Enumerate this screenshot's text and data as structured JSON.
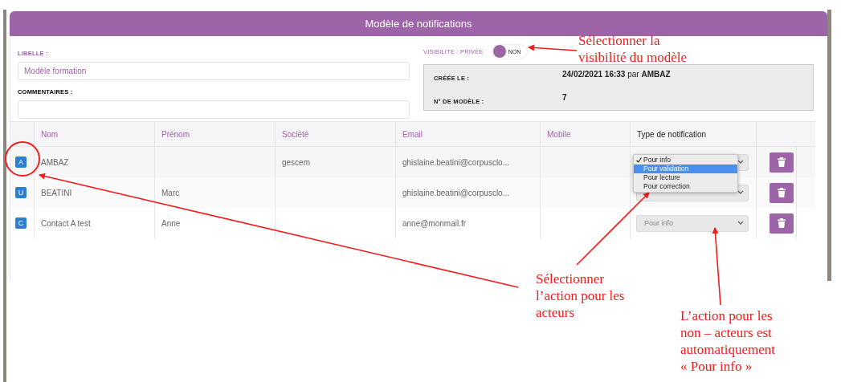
{
  "window": {
    "title": "Modèle de notifications"
  },
  "form": {
    "libelle_label": "LIBELLE :",
    "libelle_value": "Modèle formation",
    "comments_label": "COMMENTAIRES :",
    "visibility": {
      "label": "VISIBILITE : PRIVÉE",
      "toggle_text": "NON",
      "on": false
    },
    "info": [
      {
        "label": "CRÉÉE LE :",
        "value": "**24/02/2021 16:33** par **AMBAZ**"
      },
      {
        "label": "N° DE MODÈLE :",
        "value": "7"
      }
    ]
  },
  "table": {
    "columns": [
      {
        "kind": "plain"
      },
      {
        "label": "Nom",
        "kind": "sortable"
      },
      {
        "label": "Prénom",
        "kind": "sortable"
      },
      {
        "label": "Société",
        "kind": "sortable"
      },
      {
        "label": "Email",
        "kind": "sortable"
      },
      {
        "label": "Mobile",
        "kind": "sortable"
      },
      {
        "label": "Type de notification",
        "kind": "plain"
      },
      {
        "kind": "plain"
      }
    ],
    "rows": [
      {
        "type": "A",
        "nom": "AMBAZ",
        "prenom": "",
        "societe": "gescem",
        "email": "ghislaine.beatini@corpusclo...",
        "mobile": ""
      },
      {
        "type": "U",
        "nom": "BEATINI",
        "prenom": "Marc",
        "societe": "",
        "email": "ghislaine.beatini@corpusclo...",
        "mobile": ""
      },
      {
        "type": "C",
        "nom": "Contact A test",
        "prenom": "Anne",
        "societe": "",
        "email": "anne@monmail.fr",
        "mobile": "",
        "notification": {
          "value": "Pour info",
          "disabled": true
        }
      }
    ]
  },
  "open_menu": {
    "options": [
      {
        "label": "Pour info",
        "checked": true,
        "selected": false
      },
      {
        "label": "Pour validation",
        "checked": false,
        "selected": true
      },
      {
        "label": "Pour lecture",
        "checked": false,
        "selected": false
      },
      {
        "label": "Pour correction",
        "checked": false,
        "selected": false
      }
    ]
  },
  "annotations": [
    {
      "text": "Sélectionner la\nvisibilité du modèle"
    },
    {
      "text": "Sélectionner\nl’action pour les\nacteurs"
    },
    {
      "text": "L’action pour les\nnon – acteurs est\nautomatiquement\n« Pour info »"
    }
  ]
}
